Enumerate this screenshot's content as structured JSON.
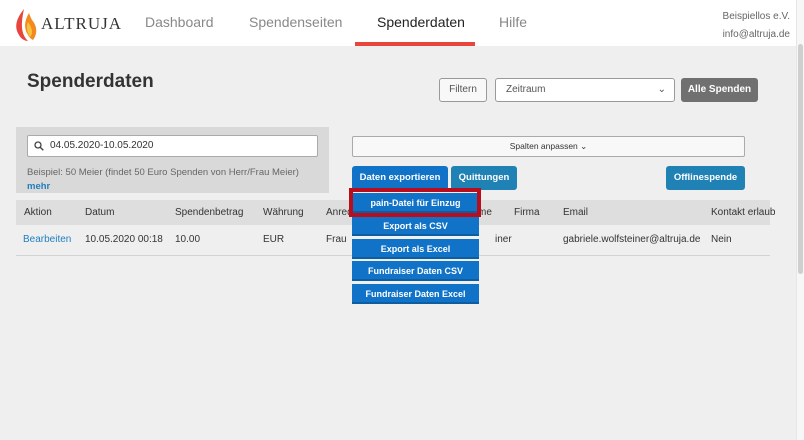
{
  "brand": {
    "name": "ALTRUJA"
  },
  "nav": {
    "items": [
      {
        "label": "Dashboard"
      },
      {
        "label": "Spendenseiten"
      },
      {
        "label": "Spenderdaten"
      },
      {
        "label": "Hilfe"
      }
    ],
    "active_index": 2
  },
  "org": {
    "name": "Beispiellos e.V.",
    "email": "info@altruja.de"
  },
  "page": {
    "title": "Spenderdaten"
  },
  "toolbar": {
    "filter_label": "Filtern",
    "zeitraum_label": "Zeitraum",
    "alle_spenden_label": "Alle Spenden"
  },
  "search": {
    "value": "04.05.2020-10.05.2020",
    "hint": "Beispiel: 50 Meier (findet 50 Euro Spenden von Herr/Frau Meier)",
    "more_label": "mehr"
  },
  "actions": {
    "spalten_label": "Spalten anpassen",
    "export_label": "Daten exportieren",
    "quittungen_label": "Quittungen",
    "offline_label": "Offlinespende"
  },
  "export_menu": {
    "items": [
      {
        "label": "pain-Datei für Einzug"
      },
      {
        "label": "Export als CSV"
      },
      {
        "label": "Export als Excel"
      },
      {
        "label": "Fundraiser Daten CSV"
      },
      {
        "label": "Fundraiser Daten Excel"
      }
    ],
    "highlighted_index": 0
  },
  "table": {
    "columns": [
      "Aktion",
      "Datum",
      "Spendenbetrag",
      "Währung",
      "Anred",
      "me",
      "Firma",
      "Email",
      "Kontakt erlaub"
    ],
    "rows": [
      {
        "aktion": "Bearbeiten",
        "datum": "10.05.2020 00:18",
        "betrag": "10.00",
        "waehrung": "EUR",
        "anrede": "Frau",
        "name": "iner",
        "firma": "",
        "email": "gabriele.wolfsteiner@altruja.de",
        "kontakt": "Nein"
      }
    ]
  },
  "colors": {
    "accent_red": "#e8453c",
    "button_blue": "#1173c7",
    "button_teal": "#1f81b4",
    "highlight_red": "#b90d1d"
  }
}
